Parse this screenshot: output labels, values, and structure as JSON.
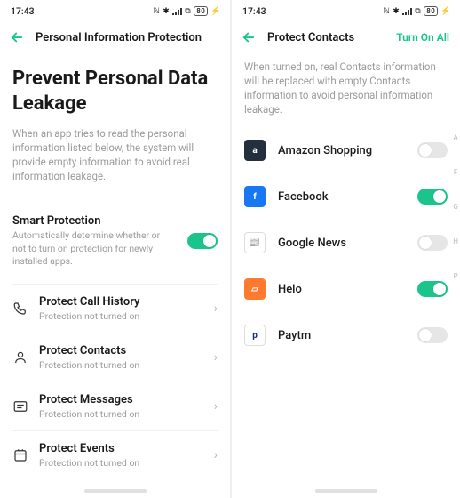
{
  "status": {
    "time": "17:43",
    "icons_right": "N ✻ 📶 ⏻ 📷 ⚡"
  },
  "left": {
    "header_title": "Personal Information Protection",
    "big_title": "Prevent Personal Data Leakage",
    "description": "When an app tries to read the personal information listed below, the system will provide empty information to avoid real information leakage.",
    "smart": {
      "title": "Smart Protection",
      "sub": "Automatically determine whether or not to turn on protection for newly installed apps.",
      "on": true
    },
    "items": [
      {
        "title": "Protect Call History",
        "sub": "Protection not turned on"
      },
      {
        "title": "Protect Contacts",
        "sub": "Protection not turned on"
      },
      {
        "title": "Protect Messages",
        "sub": "Protection not turned on"
      },
      {
        "title": "Protect Events",
        "sub": "Protection not turned on"
      }
    ]
  },
  "right": {
    "header_title": "Protect Contacts",
    "header_action": "Turn On All",
    "description": "When turned on, real Contacts information will be replaced with empty Contacts information to avoid personal information leakage.",
    "apps": [
      {
        "name": "Amazon Shopping",
        "on": false,
        "bg": "#232f3e",
        "label": "a"
      },
      {
        "name": "Facebook",
        "on": true,
        "bg": "#1877f2",
        "label": "f"
      },
      {
        "name": "Google News",
        "on": false,
        "bg": "#ffffff",
        "label": "📰",
        "border": true
      },
      {
        "name": "Helo",
        "on": true,
        "bg": "#ff7a2e",
        "label": "▱"
      },
      {
        "name": "Paytm",
        "on": false,
        "bg": "#ffffff",
        "label": "p",
        "fg": "#172b85",
        "border": true
      }
    ],
    "index_letters": [
      "A",
      "F",
      "G",
      "H",
      "P"
    ]
  }
}
